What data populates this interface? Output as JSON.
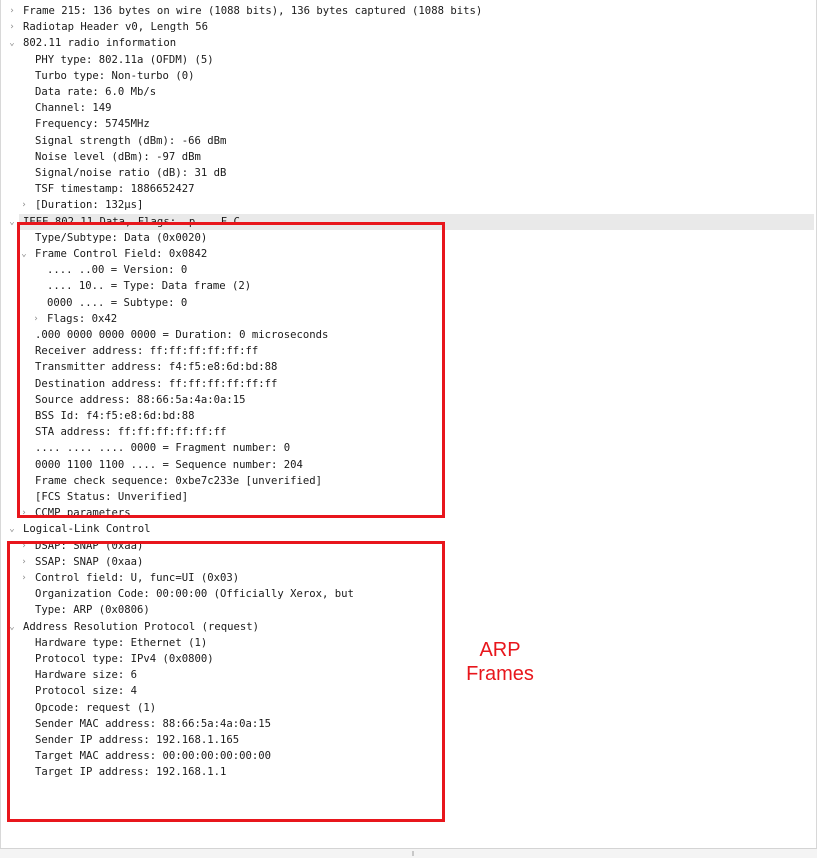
{
  "annotation": {
    "label_line1": "ARP",
    "label_line2": "Frames",
    "color": "#e8161c"
  },
  "caret_icons": {
    "collapsed": "›",
    "expanded": "⌄"
  },
  "tree": [
    {
      "text": "Frame 215: 136 bytes on wire (1088 bits), 136 bytes captured (1088 bits)",
      "state": "collapsed",
      "indent": 0
    },
    {
      "text": "Radiotap Header v0, Length 56",
      "state": "collapsed",
      "indent": 0
    },
    {
      "text": "802.11 radio information",
      "state": "expanded",
      "indent": 0
    },
    {
      "text": "PHY type: 802.11a (OFDM) (5)",
      "state": "leaf",
      "indent": 1
    },
    {
      "text": "Turbo type: Non-turbo (0)",
      "state": "leaf",
      "indent": 1
    },
    {
      "text": "Data rate: 6.0 Mb/s",
      "state": "leaf",
      "indent": 1
    },
    {
      "text": "Channel: 149",
      "state": "leaf",
      "indent": 1
    },
    {
      "text": "Frequency: 5745MHz",
      "state": "leaf",
      "indent": 1
    },
    {
      "text": "Signal strength (dBm): -66 dBm",
      "state": "leaf",
      "indent": 1
    },
    {
      "text": "Noise level (dBm): -97 dBm",
      "state": "leaf",
      "indent": 1
    },
    {
      "text": "Signal/noise ratio (dB): 31 dB",
      "state": "leaf",
      "indent": 1
    },
    {
      "text": "TSF timestamp: 1886652427",
      "state": "leaf",
      "indent": 1
    },
    {
      "text": "[Duration: 132µs]",
      "state": "collapsed",
      "indent": 1
    },
    {
      "text": "IEEE 802.11 Data, Flags: .p....F.C",
      "state": "expanded",
      "indent": 0,
      "selected": true
    },
    {
      "text": "Type/Subtype: Data (0x0020)",
      "state": "leaf",
      "indent": 1
    },
    {
      "text": "Frame Control Field: 0x0842",
      "state": "expanded",
      "indent": 1
    },
    {
      "text": ".... ..00 = Version: 0",
      "state": "leaf",
      "indent": 2
    },
    {
      "text": ".... 10.. = Type: Data frame (2)",
      "state": "leaf",
      "indent": 2
    },
    {
      "text": "0000 .... = Subtype: 0",
      "state": "leaf",
      "indent": 2
    },
    {
      "text": "Flags: 0x42",
      "state": "collapsed",
      "indent": 2
    },
    {
      "text": ".000 0000 0000 0000 = Duration: 0 microseconds",
      "state": "leaf",
      "indent": 1
    },
    {
      "text": "Receiver address: ff:ff:ff:ff:ff:ff",
      "state": "leaf",
      "indent": 1
    },
    {
      "text": "Transmitter address: f4:f5:e8:6d:bd:88",
      "state": "leaf",
      "indent": 1
    },
    {
      "text": "Destination address: ff:ff:ff:ff:ff:ff",
      "state": "leaf",
      "indent": 1
    },
    {
      "text": "Source address: 88:66:5a:4a:0a:15",
      "state": "leaf",
      "indent": 1
    },
    {
      "text": "BSS Id: f4:f5:e8:6d:bd:88",
      "state": "leaf",
      "indent": 1
    },
    {
      "text": "STA address: ff:ff:ff:ff:ff:ff",
      "state": "leaf",
      "indent": 1
    },
    {
      "text": ".... .... .... 0000 = Fragment number: 0",
      "state": "leaf",
      "indent": 1
    },
    {
      "text": "0000 1100 1100 .... = Sequence number: 204",
      "state": "leaf",
      "indent": 1
    },
    {
      "text": "Frame check sequence: 0xbe7c233e [unverified]",
      "state": "leaf",
      "indent": 1
    },
    {
      "text": "[FCS Status: Unverified]",
      "state": "leaf",
      "indent": 1
    },
    {
      "text": "CCMP parameters",
      "state": "collapsed",
      "indent": 1
    },
    {
      "text": "Logical-Link Control",
      "state": "expanded",
      "indent": 0
    },
    {
      "text": "DSAP: SNAP (0xaa)",
      "state": "collapsed",
      "indent": 1
    },
    {
      "text": "SSAP: SNAP (0xaa)",
      "state": "collapsed",
      "indent": 1
    },
    {
      "text": "Control field: U, func=UI (0x03)",
      "state": "collapsed",
      "indent": 1
    },
    {
      "text": "Organization Code: 00:00:00 (Officially Xerox, but",
      "state": "leaf",
      "indent": 1
    },
    {
      "text": "Type: ARP (0x0806)",
      "state": "leaf",
      "indent": 1
    },
    {
      "text": "Address Resolution Protocol (request)",
      "state": "expanded",
      "indent": 0
    },
    {
      "text": "Hardware type: Ethernet (1)",
      "state": "leaf",
      "indent": 1
    },
    {
      "text": "Protocol type: IPv4 (0x0800)",
      "state": "leaf",
      "indent": 1
    },
    {
      "text": "Hardware size: 6",
      "state": "leaf",
      "indent": 1
    },
    {
      "text": "Protocol size: 4",
      "state": "leaf",
      "indent": 1
    },
    {
      "text": "Opcode: request (1)",
      "state": "leaf",
      "indent": 1
    },
    {
      "text": "Sender MAC address: 88:66:5a:4a:0a:15",
      "state": "leaf",
      "indent": 1
    },
    {
      "text": "Sender IP address: 192.168.1.165",
      "state": "leaf",
      "indent": 1
    },
    {
      "text": "Target MAC address: 00:00:00:00:00:00",
      "state": "leaf",
      "indent": 1
    },
    {
      "text": "Target IP address: 192.168.1.1",
      "state": "leaf",
      "indent": 1
    }
  ]
}
